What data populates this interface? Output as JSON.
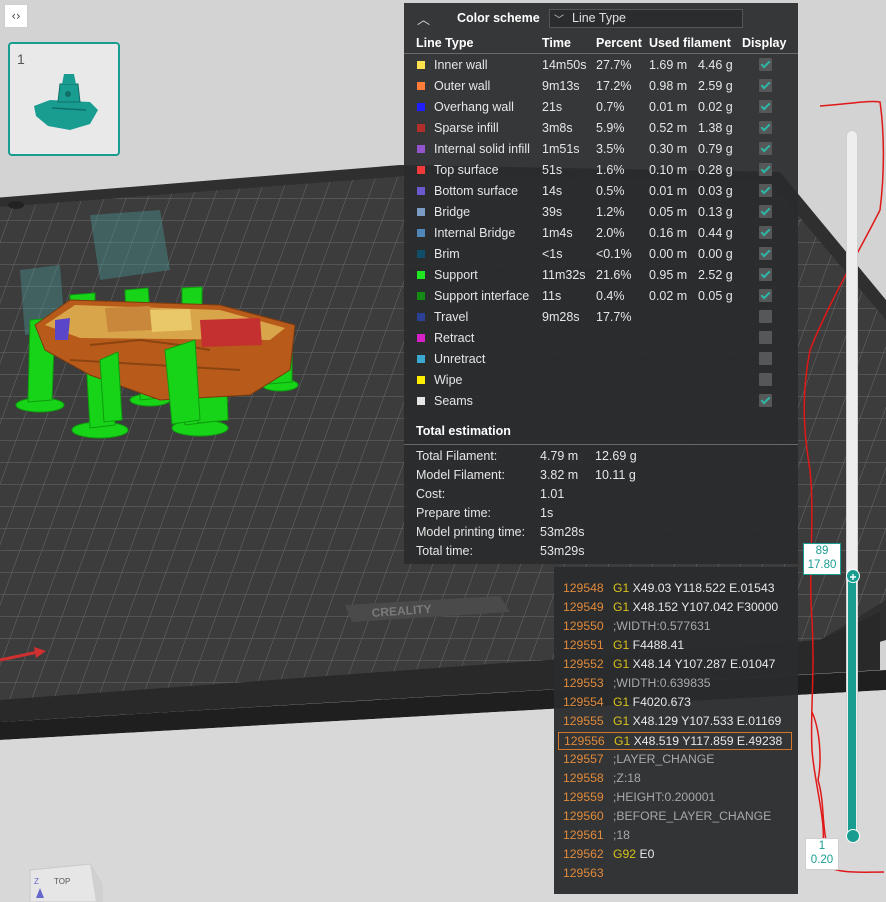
{
  "toolbar": {
    "toggle_glyph": "‹›"
  },
  "plate": {
    "number": "1",
    "brand": "CREALITY"
  },
  "legend": {
    "title": "Color scheme",
    "scheme_value": "Line Type",
    "columns": {
      "type": "Line Type",
      "time": "Time",
      "percent": "Percent",
      "filament": "Used filament",
      "display": "Display"
    },
    "rows": [
      {
        "name": "Inner wall",
        "color": "#ffe14d",
        "time": "14m50s",
        "percent": "27.7%",
        "length": "1.69 m",
        "weight": "4.46 g",
        "display": true
      },
      {
        "name": "Outer wall",
        "color": "#ff7d38",
        "time": "9m13s",
        "percent": "17.2%",
        "length": "0.98 m",
        "weight": "2.59 g",
        "display": true
      },
      {
        "name": "Overhang wall",
        "color": "#1f1fff",
        "time": "21s",
        "percent": "0.7%",
        "length": "0.01 m",
        "weight": "0.02 g",
        "display": true
      },
      {
        "name": "Sparse infill",
        "color": "#b03029",
        "time": "3m8s",
        "percent": "5.9%",
        "length": "0.52 m",
        "weight": "1.38 g",
        "display": true
      },
      {
        "name": "Internal solid infill",
        "color": "#9654cc",
        "time": "1m51s",
        "percent": "3.5%",
        "length": "0.30 m",
        "weight": "0.79 g",
        "display": true
      },
      {
        "name": "Top surface",
        "color": "#f03a3a",
        "time": "51s",
        "percent": "1.6%",
        "length": "0.10 m",
        "weight": "0.28 g",
        "display": true
      },
      {
        "name": "Bottom surface",
        "color": "#6a5acd",
        "time": "14s",
        "percent": "0.5%",
        "length": "0.01 m",
        "weight": "0.03 g",
        "display": true
      },
      {
        "name": "Bridge",
        "color": "#7a9cc4",
        "time": "39s",
        "percent": "1.2%",
        "length": "0.05 m",
        "weight": "0.13 g",
        "display": true
      },
      {
        "name": "Internal Bridge",
        "color": "#4f87b8",
        "time": "1m4s",
        "percent": "2.0%",
        "length": "0.16 m",
        "weight": "0.44 g",
        "display": true
      },
      {
        "name": "Brim",
        "color": "#0f4f6a",
        "time": "<1s",
        "percent": "<0.1%",
        "length": "0.00 m",
        "weight": "0.00 g",
        "display": true
      },
      {
        "name": "Support",
        "color": "#1ee81e",
        "time": "11m32s",
        "percent": "21.6%",
        "length": "0.95 m",
        "weight": "2.52 g",
        "display": true
      },
      {
        "name": "Support interface",
        "color": "#148c14",
        "time": "11s",
        "percent": "0.4%",
        "length": "0.02 m",
        "weight": "0.05 g",
        "display": true
      },
      {
        "name": "Travel",
        "color": "#2a3f96",
        "time": "9m28s",
        "percent": "17.7%",
        "length": "",
        "weight": "",
        "display": false
      },
      {
        "name": "Retract",
        "color": "#d621c9",
        "time": "",
        "percent": "",
        "length": "",
        "weight": "",
        "display": false
      },
      {
        "name": "Unretract",
        "color": "#3ba8cf",
        "time": "",
        "percent": "",
        "length": "",
        "weight": "",
        "display": false
      },
      {
        "name": "Wipe",
        "color": "#ffee00",
        "time": "",
        "percent": "",
        "length": "",
        "weight": "",
        "display": false
      },
      {
        "name": "Seams",
        "color": "#e6e6e6",
        "time": "",
        "percent": "",
        "length": "",
        "weight": "",
        "display": true
      }
    ],
    "totals_title": "Total estimation",
    "totals": [
      {
        "label": "Total Filament:",
        "v1": "4.79 m",
        "v2": "12.69 g"
      },
      {
        "label": "Model Filament:",
        "v1": "3.82 m",
        "v2": "10.11 g"
      },
      {
        "label": "Cost:",
        "v1": "1.01",
        "v2": ""
      },
      {
        "label": "Prepare time:",
        "v1": "1s",
        "v2": ""
      },
      {
        "label": "Model printing time:",
        "v1": "53m28s",
        "v2": ""
      },
      {
        "label": "Total time:",
        "v1": "53m29s",
        "v2": ""
      }
    ]
  },
  "gcode": {
    "lines": [
      {
        "num": "129548",
        "cmd": "G1",
        "args": "X49.03 Y118.522 E.01543",
        "comment": ""
      },
      {
        "num": "129549",
        "cmd": "G1",
        "args": "X48.152 Y107.042 F30000",
        "comment": ""
      },
      {
        "num": "129550",
        "cmd": "",
        "args": "",
        "comment": ";WIDTH:0.577631"
      },
      {
        "num": "129551",
        "cmd": "G1",
        "args": "F4488.41",
        "comment": ""
      },
      {
        "num": "129552",
        "cmd": "G1",
        "args": "X48.14 Y107.287 E.01047",
        "comment": ""
      },
      {
        "num": "129553",
        "cmd": "",
        "args": "",
        "comment": ";WIDTH:0.639835"
      },
      {
        "num": "129554",
        "cmd": "G1",
        "args": "F4020.673",
        "comment": ""
      },
      {
        "num": "129555",
        "cmd": "G1",
        "args": "X48.129 Y107.533 E.01169",
        "comment": ""
      },
      {
        "num": "129556",
        "cmd": "G1",
        "args": "X48.519 Y117.859 E.49238",
        "comment": "",
        "current": true
      },
      {
        "num": "129557",
        "cmd": "",
        "args": "",
        "comment": ";LAYER_CHANGE"
      },
      {
        "num": "129558",
        "cmd": "",
        "args": "",
        "comment": ";Z:18"
      },
      {
        "num": "129559",
        "cmd": "",
        "args": "",
        "comment": ";HEIGHT:0.200001"
      },
      {
        "num": "129560",
        "cmd": "",
        "args": "",
        "comment": ";BEFORE_LAYER_CHANGE"
      },
      {
        "num": "129561",
        "cmd": "",
        "args": "",
        "comment": ";18"
      },
      {
        "num": "129562",
        "cmd": "G92",
        "args": "E0",
        "comment": ""
      },
      {
        "num": "129563",
        "cmd": "",
        "args": "",
        "comment": ""
      }
    ]
  },
  "layer_slider": {
    "upper_layer": "89",
    "upper_height": "17.80",
    "lower_layer": "1",
    "lower_height": "0.20",
    "accent": "#1a9d91"
  },
  "view_cube": {
    "face": "TOP",
    "axis": "Z"
  }
}
